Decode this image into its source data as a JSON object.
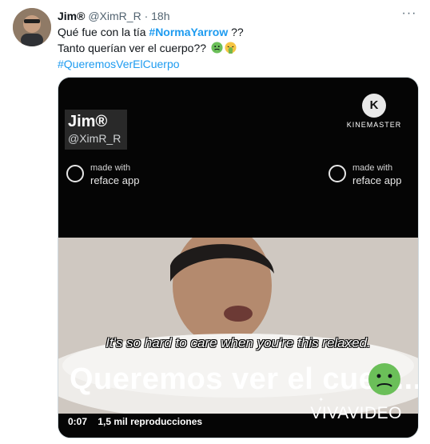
{
  "tweet": {
    "name": "Jim®",
    "handle": "@XimR_R",
    "separator": "·",
    "time": "18h",
    "more_label": "···",
    "lines": [
      {
        "prefix": "Qué fue con la tía ",
        "hashtag": "#NormaYarrow",
        "suffix": " ??"
      },
      {
        "text": "Tanto querían ver el cuerpo??"
      },
      {
        "hashtag": "#QueremosVerElCuerpo"
      }
    ]
  },
  "media": {
    "overlay_name": "Jim®",
    "overlay_handle": "@XimR_R",
    "kinemaster_label": "KINEMASTER",
    "kinemaster_logo": "K",
    "reface_made_with": "made with",
    "reface_app": "reface app",
    "subtitle": "It's so hard to care when you're this relaxed.",
    "caption": "Queremos ver el cuer....",
    "watermark": "VIVAVIDEO",
    "elapsed": "0:07",
    "views": "1,5 mil reproducciones"
  },
  "colors": {
    "accent": "#1d9bf0",
    "secondary_text": "#536471"
  },
  "icons": [
    "nauseated-face-icon",
    "vomiting-face-icon",
    "more-icon",
    "kinemaster-logo-icon",
    "reface-logo-icon"
  ]
}
